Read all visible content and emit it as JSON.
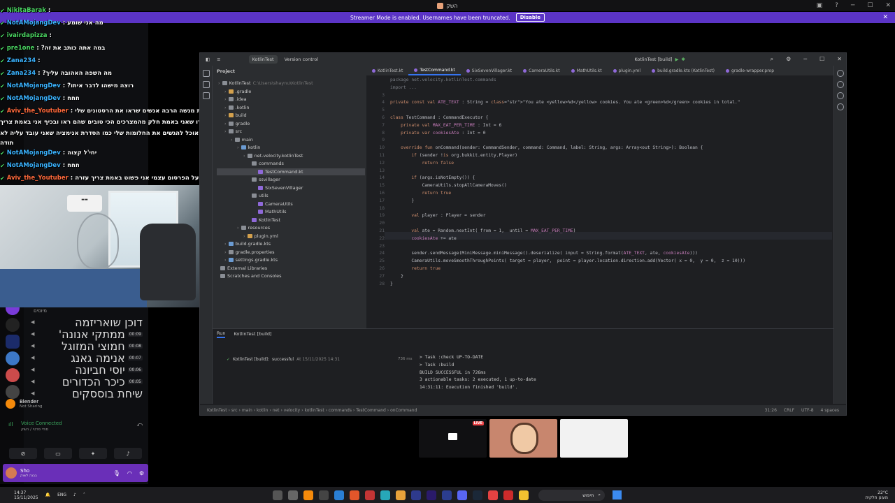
{
  "window": {
    "title": "השק"
  },
  "banner": {
    "text": "Streamer Mode is enabled. Usernames have been truncated.",
    "button": "Disable"
  },
  "chat": {
    "messages": [
      {
        "user": "NikitaBarak",
        "text": "",
        "color": "g"
      },
      {
        "user": "NotAMojangDev",
        "text": "מה אני שומע",
        "color": "b"
      },
      {
        "user": "ivairdapizza",
        "text": "",
        "color": "g"
      },
      {
        "user": "pre1one",
        "text": "במה אתה כותב את זה?",
        "color": "g"
      },
      {
        "user": "Zana234",
        "text": "",
        "color": "b"
      },
      {
        "user": "Zana234",
        "text": "מה השפה האהובה עליך?",
        "color": "b"
      },
      {
        "user": "NotAMojangDev",
        "text": "רוצה מישהו לדבר איתו?",
        "color": "b"
      },
      {
        "user": "NotAMojangDev",
        "text": "חחח",
        "color": "b"
      },
      {
        "user": "Aviv_the_Youtuber",
        "text": "אני באמת מנשה הרבה אנשים שראו את הרסטונים שלי",
        "color": "r"
      },
      {
        "user": "",
        "text": "באמת אמרו שאני באמת חלק מהמצרכים הכי טובים שהם ראו ובכיף אני באמת צריך",
        "color": "r"
      },
      {
        "user": "",
        "text": "עזרה אני לא אוכל להגשים את החלומות שלי כמו הסדרת אנימציה שאני עובד עליה לא",
        "color": "r"
      },
      {
        "user": "",
        "text": "תודה",
        "color": "r"
      },
      {
        "user": "NotAMojangDev",
        "text": "יחי'ל קצוה",
        "color": "b"
      },
      {
        "user": "NotAMojangDev",
        "text": "חחח",
        "color": "b"
      },
      {
        "user": "Aviv_the_Youtuber",
        "text": "סליחה על הפרסום עצמי אני פשוט באמת צריך עזרה",
        "color": "r"
      }
    ]
  },
  "discord": {
    "category": "מיוסים",
    "voice_members": [
      {
        "name": "דוכן שואריזמה",
        "time": ""
      },
      {
        "name": "ממתקי אנונה'",
        "time": "00:09"
      },
      {
        "name": "חמוצי המזוגל",
        "time": "00:08"
      },
      {
        "name": "אנימה גאנג",
        "time": "00:07"
      },
      {
        "name": "יוסי חביונה",
        "time": "00:06"
      },
      {
        "name": "כיכר הכדורים",
        "time": "00:05"
      },
      {
        "name": "שיחת בוססקים",
        "time": ""
      }
    ],
    "activity": {
      "name": "Blender",
      "status": "Not Sharing"
    },
    "voice": {
      "status": "Voice Connected",
      "channel": "סודי פרטי / השק"
    },
    "user": {
      "name": "Sho",
      "status": "בבנה לשוק"
    }
  },
  "ide": {
    "project_name": "KotlinTest",
    "vcs": "Version control",
    "run_config": "KotlinTest [build]",
    "pane_title": "Project",
    "tabs": [
      "KotlinTest.kt",
      "TestCommand.kt",
      "SixSevenVillager.kt",
      "CameraUtils.kt",
      "MathUtils.kt",
      "plugin.yml",
      "build.gradle.kts (KotlinTest)",
      "gradle-wrapper.prop"
    ],
    "tree": [
      {
        "label": "KotlinTest",
        "extra": "C:\\Users\\shaynu\\KotlinTest",
        "indent": 0,
        "color": "#8a8e95"
      },
      {
        "label": ".gradle",
        "indent": 1,
        "color": "#d3a04d"
      },
      {
        "label": ".idea",
        "indent": 1,
        "color": "#8a8e95"
      },
      {
        "label": ".kotlin",
        "indent": 1,
        "color": "#8a8e95"
      },
      {
        "label": "build",
        "indent": 1,
        "color": "#d3a04d"
      },
      {
        "label": "gradle",
        "indent": 1,
        "color": "#8a8e95"
      },
      {
        "label": "src",
        "indent": 1,
        "color": "#8a8e95"
      },
      {
        "label": "main",
        "indent": 2,
        "color": "#8a8e95"
      },
      {
        "label": "kotlin",
        "indent": 3,
        "color": "#6b9bd2"
      },
      {
        "label": "net.velocity.kotlinTest",
        "indent": 4,
        "color": "#8a8e95"
      },
      {
        "label": "commands",
        "indent": 5,
        "color": "#8a8e95"
      },
      {
        "label": "TestCommand.kt",
        "indent": 6,
        "color": "#8f69d9"
      },
      {
        "label": "ssvillager",
        "indent": 5,
        "color": "#8a8e95"
      },
      {
        "label": "SixSevenVillager",
        "indent": 6,
        "color": "#8f69d9"
      },
      {
        "label": "utils",
        "indent": 5,
        "color": "#8a8e95"
      },
      {
        "label": "CameraUtils",
        "indent": 6,
        "color": "#8f69d9"
      },
      {
        "label": "MathUtils",
        "indent": 6,
        "color": "#8f69d9"
      },
      {
        "label": "KotlinTest",
        "indent": 5,
        "color": "#8f69d9"
      },
      {
        "label": "resources",
        "indent": 3,
        "color": "#8a8e95"
      },
      {
        "label": "plugin.yml",
        "indent": 4,
        "color": "#d3a04d"
      },
      {
        "label": "build.gradle.kts",
        "indent": 1,
        "color": "#6b9bd2"
      },
      {
        "label": "gradle.properties",
        "indent": 1,
        "color": "#8a8e95"
      },
      {
        "label": "settings.gradle.kts",
        "indent": 1,
        "color": "#6b9bd2"
      },
      {
        "label": "External Libraries",
        "indent": 0,
        "color": "#8a8e95"
      },
      {
        "label": "Scratches and Consoles",
        "indent": 0,
        "color": "#8a8e95"
      }
    ],
    "code_lines": [
      {
        "n": "",
        "t": "package net.velocity.kotlinTest.commands"
      },
      {
        "n": "",
        "t": "import ..."
      },
      {
        "n": "",
        "t": ""
      },
      {
        "n": "",
        "t": "private const val ATE_TEXT : String = \"You ate <yellow>%d</yellow> cookies. You ate <green>%d</green> cookies in total.\""
      },
      {
        "n": "",
        "t": ""
      },
      {
        "n": "",
        "t": "class TestCommand : CommandExecutor {"
      },
      {
        "n": "",
        "t": "    private val MAX_EAT_PER_TIME : Int = 6"
      },
      {
        "n": "",
        "t": "    private var cookiesAte : Int = 0"
      },
      {
        "n": "",
        "t": ""
      },
      {
        "n": "",
        "t": "    override fun onCommand(sender: CommandSender, command: Command, label: String, args: Array<out String>): Boolean {"
      },
      {
        "n": "",
        "t": "        if (sender !is org.bukkit.entity.Player)"
      },
      {
        "n": "",
        "t": "            return false"
      },
      {
        "n": "",
        "t": ""
      },
      {
        "n": "",
        "t": "        if (args.isNotEmpty()) {"
      },
      {
        "n": "",
        "t": "            CameraUtils.stopAllCameraMoves()"
      },
      {
        "n": "",
        "t": "            return true"
      },
      {
        "n": "",
        "t": "        }"
      },
      {
        "n": "",
        "t": ""
      },
      {
        "n": "",
        "t": "        val player : Player = sender"
      },
      {
        "n": "",
        "t": ""
      },
      {
        "n": "",
        "t": "        val ate = Random.nextInt( from = 1,  until = MAX_EAT_PER_TIME)"
      },
      {
        "n": "",
        "t": "        cookiesAte += ate"
      },
      {
        "n": "",
        "t": ""
      },
      {
        "n": "",
        "t": "        sender.sendMessage(MiniMessage.miniMessage().deserialize( input = String.format(ATE_TEXT, ate, cookiesAte)))"
      },
      {
        "n": "",
        "t": "        CameraUtils.moveSmoothThroughPoints( target = player,  point = player.location.direction.add(Vector( x = 0,  y = 0,  z = 10)))"
      },
      {
        "n": "",
        "t": "        return true"
      },
      {
        "n": "",
        "t": "    }"
      },
      {
        "n": "",
        "t": "}"
      }
    ],
    "run": {
      "tab1": "Run",
      "tab2": "KotlinTest [build]",
      "item": "KotlinTest [build]:",
      "result": "successful",
      "when": "At 15/11/2025 14:31",
      "duration": "736 ms",
      "console": [
        "> Task :check UP-TO-DATE",
        "> Task :build",
        "",
        "BUILD SUCCESSFUL in 726ms",
        "3 actionable tasks: 2 executed, 1 up-to-date",
        "14:31:11: Execution finished 'build'."
      ]
    },
    "breadcrumb": [
      "KotlinTest",
      "src",
      "main",
      "kotlin",
      "net",
      "velocity",
      "kotlinTest",
      "commands",
      "TestCommand",
      "onCommand"
    ],
    "status": {
      "pos": "31:26",
      "eol": "CRLF",
      "enc": "UTF-8",
      "indent": "4 spaces"
    }
  },
  "streams": {
    "live": "LIVE"
  },
  "taskbar": {
    "time": "14:37",
    "date": "15/11/2025",
    "lang": "ENG",
    "search": "חיפוש",
    "weather_temp": "22°C",
    "weather_desc": "מעונן חלקית"
  },
  "colors": {
    "banner": "#5b34c6",
    "accent": "#3574f0",
    "live": "#ed4245"
  }
}
